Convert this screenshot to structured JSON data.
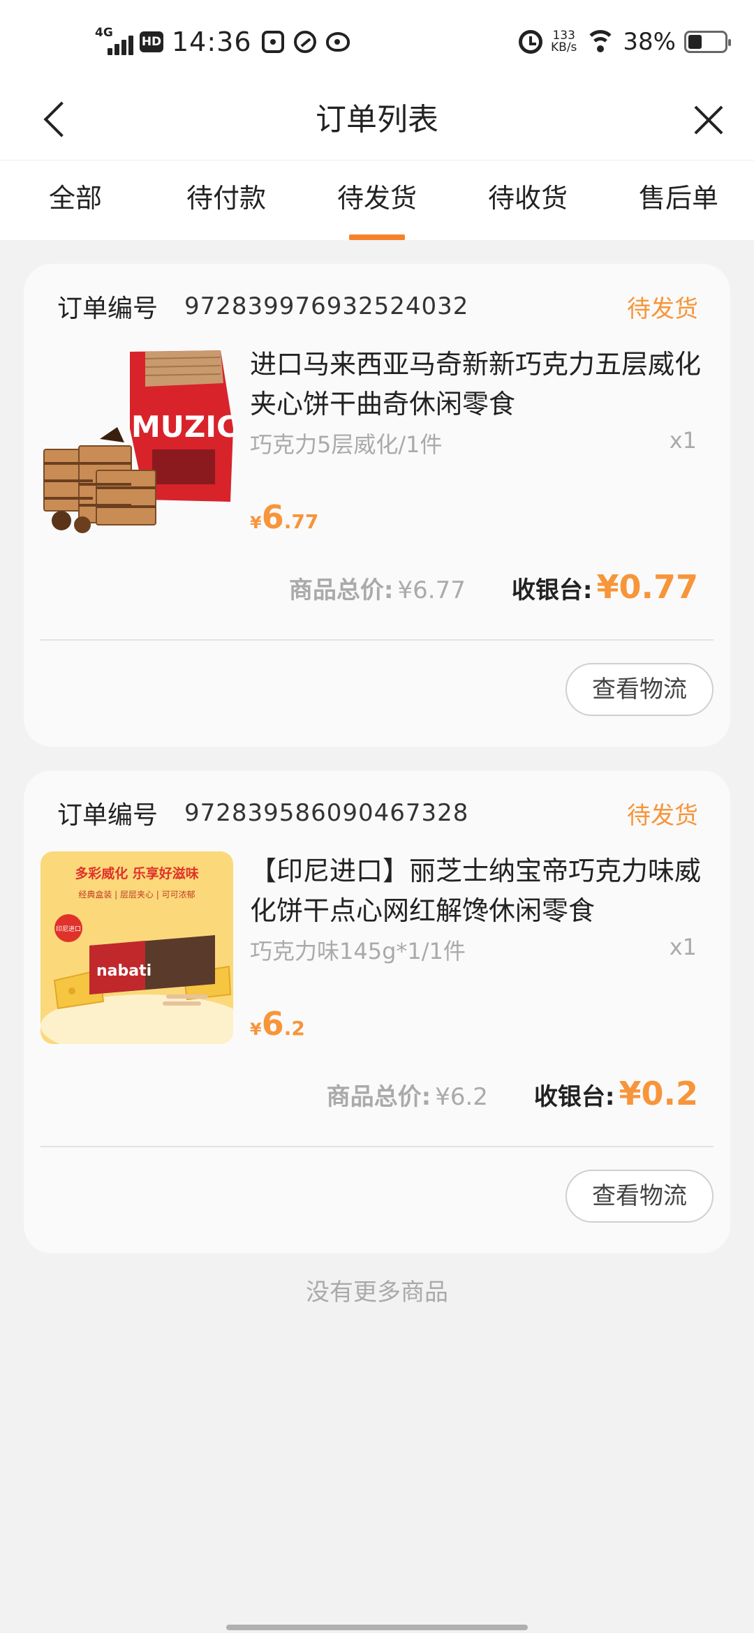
{
  "status_bar": {
    "network": "4G",
    "hd": "HD",
    "time": "14:36",
    "speed_value": "133",
    "speed_unit": "KB/s",
    "battery_percent": "38%",
    "battery_level": 0.38
  },
  "nav": {
    "title": "订单列表"
  },
  "tabs": [
    {
      "label": "全部"
    },
    {
      "label": "待付款"
    },
    {
      "label": "待发货",
      "active": true
    },
    {
      "label": "待收货"
    },
    {
      "label": "售后单"
    }
  ],
  "orders": [
    {
      "order_label": "订单编号",
      "order_no": "972839976932524032",
      "status": "待发货",
      "product_title": "进口马来西亚马奇新新巧克力五层威化夹心饼干曲奇休闲零食",
      "spec": "巧克力5层威化/1件",
      "qty": "x1",
      "price_currency": "¥",
      "price_int": "6",
      "price_dec": ".77",
      "image_text": "MUZIC",
      "goods_total_label": "商品总价:",
      "goods_total_value": "¥6.77",
      "cashier_label": "收银台:",
      "cashier_value": "¥0.77",
      "button_label": "查看物流"
    },
    {
      "order_label": "订单编号",
      "order_no": "972839586090467328",
      "status": "待发货",
      "product_title": "【印尼进口】丽芝士纳宝帝巧克力味威化饼干点心网红解馋休闲零食",
      "spec": "巧克力味145g*1/1件",
      "qty": "x1",
      "price_currency": "¥",
      "price_int": "6",
      "price_dec": ".2",
      "image_headline": "多彩威化 乐享好滋味",
      "image_sub": "经典盒装 | 层层夹心 | 可可浓郁",
      "image_badge": "印尼进口",
      "image_brand": "nabati",
      "goods_total_label": "商品总价:",
      "goods_total_value": "¥6.2",
      "cashier_label": "收银台:",
      "cashier_value": "¥0.2",
      "button_label": "查看物流"
    }
  ],
  "footer": {
    "no_more": "没有更多商品"
  },
  "colors": {
    "accent": "#f7953a",
    "tab_indicator": "#f7812b",
    "background": "#f2f2f2"
  }
}
